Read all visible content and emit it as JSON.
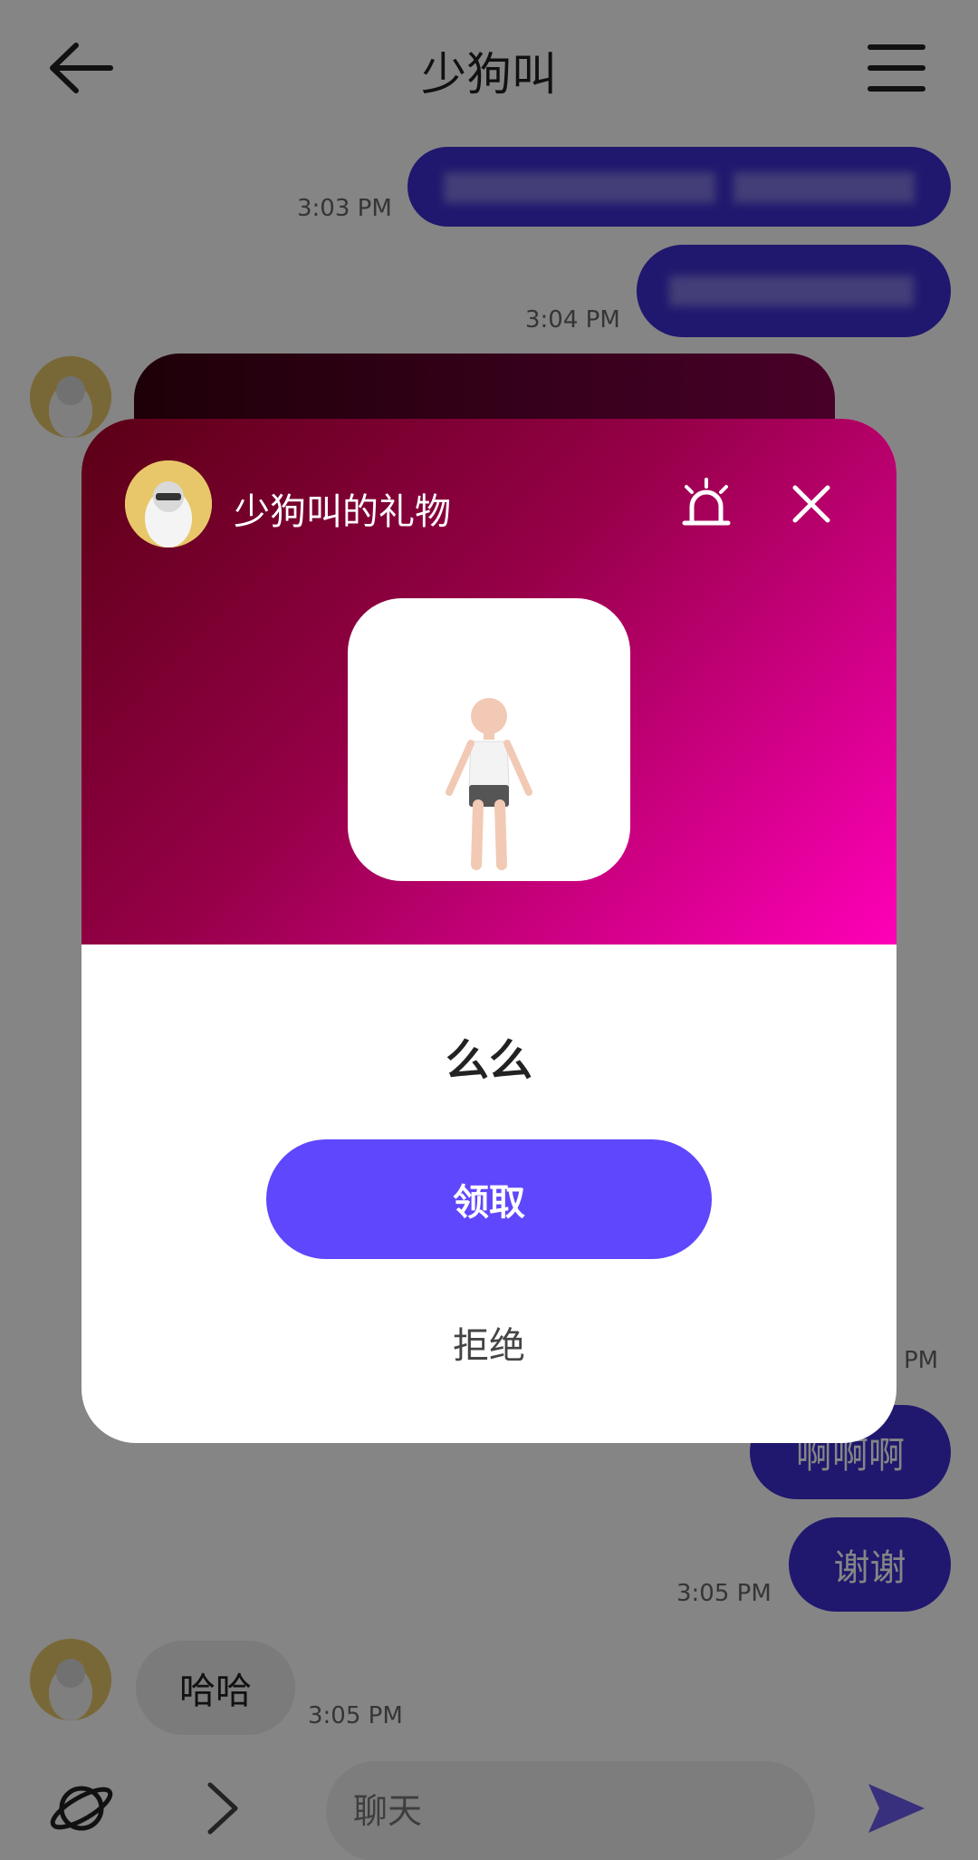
{
  "header": {
    "title": "少狗叫"
  },
  "messages": {
    "out1_time": "3:03 PM",
    "out2_time": "3:04 PM",
    "out3_time_partial": "PM",
    "out3_text": "啊啊啊",
    "out4_text": "谢谢",
    "out4_time": "3:05 PM",
    "in1_text": "哈哈",
    "in1_time": "3:05 PM"
  },
  "input": {
    "placeholder": "聊天"
  },
  "gift_dialog": {
    "title": "少狗叫的礼物",
    "message": "么么",
    "accept_label": "领取",
    "decline_label": "拒绝"
  },
  "colors": {
    "outgoing_bubble": "#3d2fd3",
    "accept_button": "#5e47fc",
    "dialog_gradient_start": "#5a0014",
    "dialog_gradient_end": "#ff00b8"
  },
  "icons": [
    "back-arrow-icon",
    "menu-icon",
    "alarm-icon",
    "close-icon",
    "planet-icon",
    "chevron-right-icon",
    "send-icon"
  ]
}
